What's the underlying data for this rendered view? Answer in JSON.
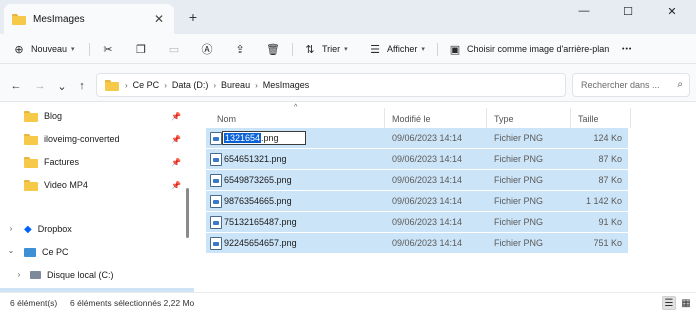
{
  "window": {
    "tab_title": "MesImages",
    "close_glyph": "✕",
    "new_tab_glyph": "+",
    "minimize_glyph": "—",
    "maximize_glyph": "☐",
    "close_window_glyph": "✕"
  },
  "toolbar": {
    "new_label": "Nouveau",
    "sort_label": "Trier",
    "view_label": "Afficher",
    "wallpaper_label": "Choisir comme image d'arrière-plan",
    "more_glyph": "•••",
    "icons": [
      "plus-circle-icon",
      "cut-icon",
      "copy-icon",
      "paste-icon",
      "rename-icon",
      "share-icon",
      "delete-icon",
      "sort-icon",
      "view-icon",
      "wallpaper-icon"
    ]
  },
  "address": {
    "crumbs": [
      "Ce PC",
      "Data (D:)",
      "Bureau",
      "MesImages"
    ],
    "search_placeholder": "Rechercher dans ..."
  },
  "sidebar": {
    "items": [
      {
        "label": "Blog",
        "pinned": true
      },
      {
        "label": "iloveimg-converted",
        "pinned": true
      },
      {
        "label": "Factures",
        "pinned": true
      },
      {
        "label": "Video MP4",
        "pinned": true
      },
      {
        "label": "Dropbox"
      },
      {
        "label": "Ce PC"
      },
      {
        "label": "Disque local (C:)"
      }
    ]
  },
  "table": {
    "headers": {
      "name": "Nom",
      "modified": "Modifié le",
      "type": "Type",
      "size": "Taille"
    },
    "rows": [
      {
        "name": "1321654.png",
        "date": "09/06/2023 14:14",
        "type": "Fichier PNG",
        "size": "124 Ko"
      },
      {
        "name": "654651321.png",
        "date": "09/06/2023 14:14",
        "type": "Fichier PNG",
        "size": "87 Ko"
      },
      {
        "name": "6549873265.png",
        "date": "09/06/2023 14:14",
        "type": "Fichier PNG",
        "size": "87 Ko"
      },
      {
        "name": "9876354665.png",
        "date": "09/06/2023 14:14",
        "type": "Fichier PNG",
        "size": "1 142 Ko"
      },
      {
        "name": "75132165487.png",
        "date": "09/06/2023 14:14",
        "type": "Fichier PNG",
        "size": "91 Ko"
      },
      {
        "name": "92245654657.png",
        "date": "09/06/2023 14:14",
        "type": "Fichier PNG",
        "size": "751 Ko"
      }
    ],
    "rename": {
      "selected_part": "1321654",
      "extension": ".png"
    }
  },
  "status": {
    "count": "6 élément(s)",
    "selection": "6 éléments sélectionnés 2,22 Mo"
  }
}
